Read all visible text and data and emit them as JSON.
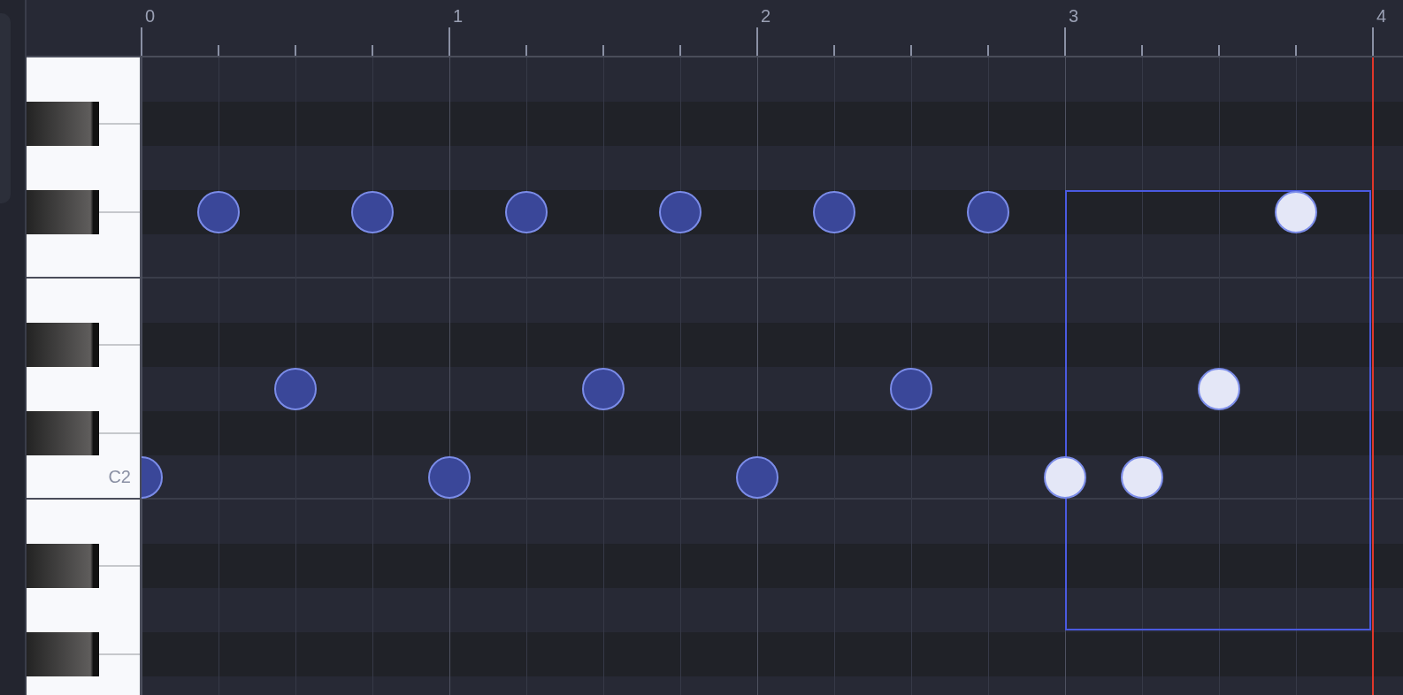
{
  "ruler": {
    "labels": [
      "0",
      "1",
      "2",
      "3",
      "4"
    ]
  },
  "rows": [
    {
      "kind": "white"
    },
    {
      "kind": "black"
    },
    {
      "kind": "white"
    },
    {
      "kind": "black",
      "steps": [
        {
          "kind": "rest"
        },
        {
          "kind": "note",
          "selected": false
        },
        {
          "kind": "rest"
        },
        {
          "kind": "note",
          "selected": false
        },
        {
          "kind": "rest"
        },
        {
          "kind": "note",
          "selected": false
        },
        {
          "kind": "rest"
        },
        {
          "kind": "note",
          "selected": false
        },
        {
          "kind": "rest"
        },
        {
          "kind": "note",
          "selected": false
        },
        {
          "kind": "rest"
        },
        {
          "kind": "note",
          "selected": false
        },
        {
          "kind": "rest"
        },
        {
          "kind": "rest"
        },
        {
          "kind": "rest"
        },
        {
          "kind": "note",
          "selected": true
        }
      ]
    },
    {
      "kind": "white"
    },
    {
      "kind": "white"
    },
    {
      "kind": "black"
    },
    {
      "kind": "white",
      "steps": [
        {
          "kind": "rest"
        },
        {
          "kind": "rest"
        },
        {
          "kind": "note",
          "selected": false
        },
        {
          "kind": "rest"
        },
        {
          "kind": "rest"
        },
        {
          "kind": "rest"
        },
        {
          "kind": "note",
          "selected": false
        },
        {
          "kind": "rest"
        },
        {
          "kind": "rest"
        },
        {
          "kind": "rest"
        },
        {
          "kind": "note",
          "selected": false
        },
        {
          "kind": "rest"
        },
        {
          "kind": "rest"
        },
        {
          "kind": "rest"
        },
        {
          "kind": "note",
          "selected": true
        },
        {
          "kind": "rest"
        }
      ]
    },
    {
      "kind": "black"
    },
    {
      "kind": "white",
      "label": "C2",
      "steps": [
        {
          "kind": "note",
          "selected": false
        },
        {
          "kind": "rest"
        },
        {
          "kind": "rest"
        },
        {
          "kind": "rest"
        },
        {
          "kind": "note",
          "selected": false
        },
        {
          "kind": "rest"
        },
        {
          "kind": "rest"
        },
        {
          "kind": "rest"
        },
        {
          "kind": "note",
          "selected": false
        },
        {
          "kind": "rest"
        },
        {
          "kind": "rest"
        },
        {
          "kind": "rest"
        },
        {
          "kind": "note",
          "selected": true
        },
        {
          "kind": "note",
          "selected": true
        },
        {
          "kind": "rest"
        },
        {
          "kind": "rest"
        }
      ]
    },
    {
      "kind": "white"
    },
    {
      "kind": "black"
    },
    {
      "kind": "white"
    },
    {
      "kind": "black"
    },
    {
      "kind": "white"
    }
  ]
}
